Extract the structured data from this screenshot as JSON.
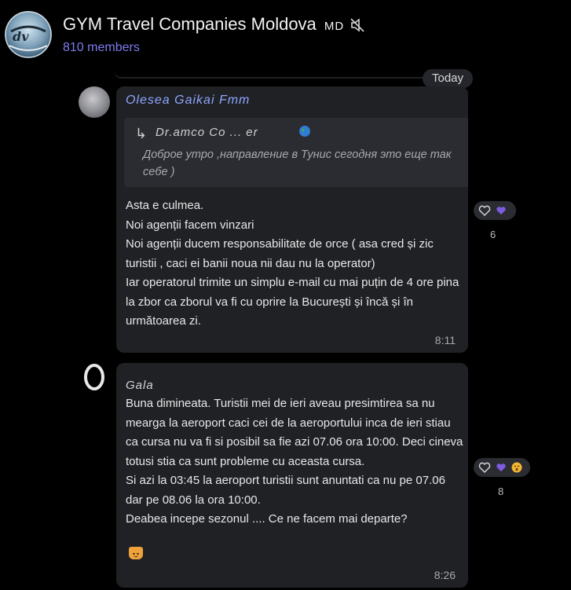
{
  "header": {
    "title": "GYM Travel Companies Moldova",
    "title_suffix": "MD",
    "members": "810 members",
    "muted_icon": "speaker-muted-icon"
  },
  "date_chip": "Today",
  "messages": [
    {
      "sender": "Olesea Gaikai Fmm",
      "reply": {
        "name": "Dr.amco Co ... er",
        "text": "Доброе утро ,направление в Тунис сегодня это еще так себе )"
      },
      "text": "Asta e culmea.\nNoi agenții facem vinzari\nNoi agenții ducem responsabilitate de orce ( asa cred și zic turistii , caci ei banii noua nii dau nu la operator)\nIar operatorul trimite un simplu e-mail cu mai puțin de 4 ore pina la zbor ca zborul va fi cu oprire la București și încă și în următoarea zi.",
      "time": "8:11",
      "reactions": {
        "count": "6",
        "icons": [
          "heart-outline-icon",
          "purple-heart-icon"
        ]
      }
    },
    {
      "sender": "Gala",
      "text": "Buna dimineata. Turistii mei de ieri aveau presimtirea sa nu mearga la aeroport caci cei de la aeroportului inca de ieri stiau ca cursa nu va fi si posibil sa fie azi 07.06 ora 10:00. Deci cineva totusi stia ca sunt probleme cu aceasta cursa.\nSi azi la 03:45 la aeroport turistii sunt anuntati ca nu pe 07.06 dar pe 08.06 la ora 10:00.\nDeabea incepe sezonul ....  Ce ne facem mai departe?",
      "time": "8:26",
      "reactions": {
        "count": "8",
        "icons": [
          "heart-outline-icon",
          "purple-heart-icon",
          "astonished-face-icon"
        ]
      }
    }
  ],
  "colors": {
    "background": "#000000",
    "bubble": "#1f2125",
    "accent": "#7f7cf0",
    "sender_name": "#8fa6ff"
  }
}
